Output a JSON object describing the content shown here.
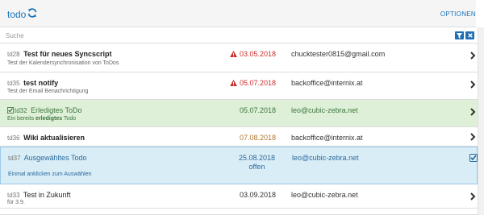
{
  "header": {
    "title": "todo",
    "refresh_icon": "refresh-icon",
    "options_label": "OPTIONEN"
  },
  "search": {
    "placeholder": "Suche",
    "value": "",
    "filter_icon": "filter-icon",
    "clear_icon": "close-icon"
  },
  "colors": {
    "accent": "#1a73b8",
    "overdue": "#c9302c",
    "done_bg": "#dff0d8",
    "done_text": "#3c763d",
    "selected_bg": "#d9edf7",
    "selected_text": "#2b6a9c",
    "upcoming": "#b0772d"
  },
  "todos": [
    {
      "id": "td28",
      "title": "Test für neues Syncscript",
      "subtitle": "Test der Kalendersynchronisation von ToDos",
      "date": "03.05.2018",
      "overdue": true,
      "email": "chucktester0815@gmail.com"
    },
    {
      "id": "td35",
      "title": "test notify",
      "subtitle": "Test der Email Benachrichtigung",
      "date": "05.07.2018",
      "overdue": true,
      "email": "backoffice@internix.at"
    },
    {
      "id": "td32",
      "title": "Erledigtes ToDo",
      "subtitle_pre": "Ein bereits ",
      "subtitle_bold": "erledigtes",
      "subtitle_post": " Todo",
      "date": "05.07.2018",
      "email": "leo@cubic-zebra.net",
      "state": "done"
    },
    {
      "id": "td36",
      "title": "Wiki aktualisieren",
      "date": "07.08.2018",
      "email": "backoffice@internix.at"
    },
    {
      "id": "td37",
      "title": "Ausgewähltes Todo",
      "subtitle": "Einmal anklicken zum Auswählen",
      "date": "25.08.2018",
      "status": "offen",
      "email": "leo@cubic-zebra.net",
      "state": "selected"
    },
    {
      "id": "td33",
      "title": "Test in Zukunft",
      "subtitle": "für 3.9.",
      "date": "03.09.2018",
      "email": "leo@cubic-zebra.net"
    }
  ]
}
